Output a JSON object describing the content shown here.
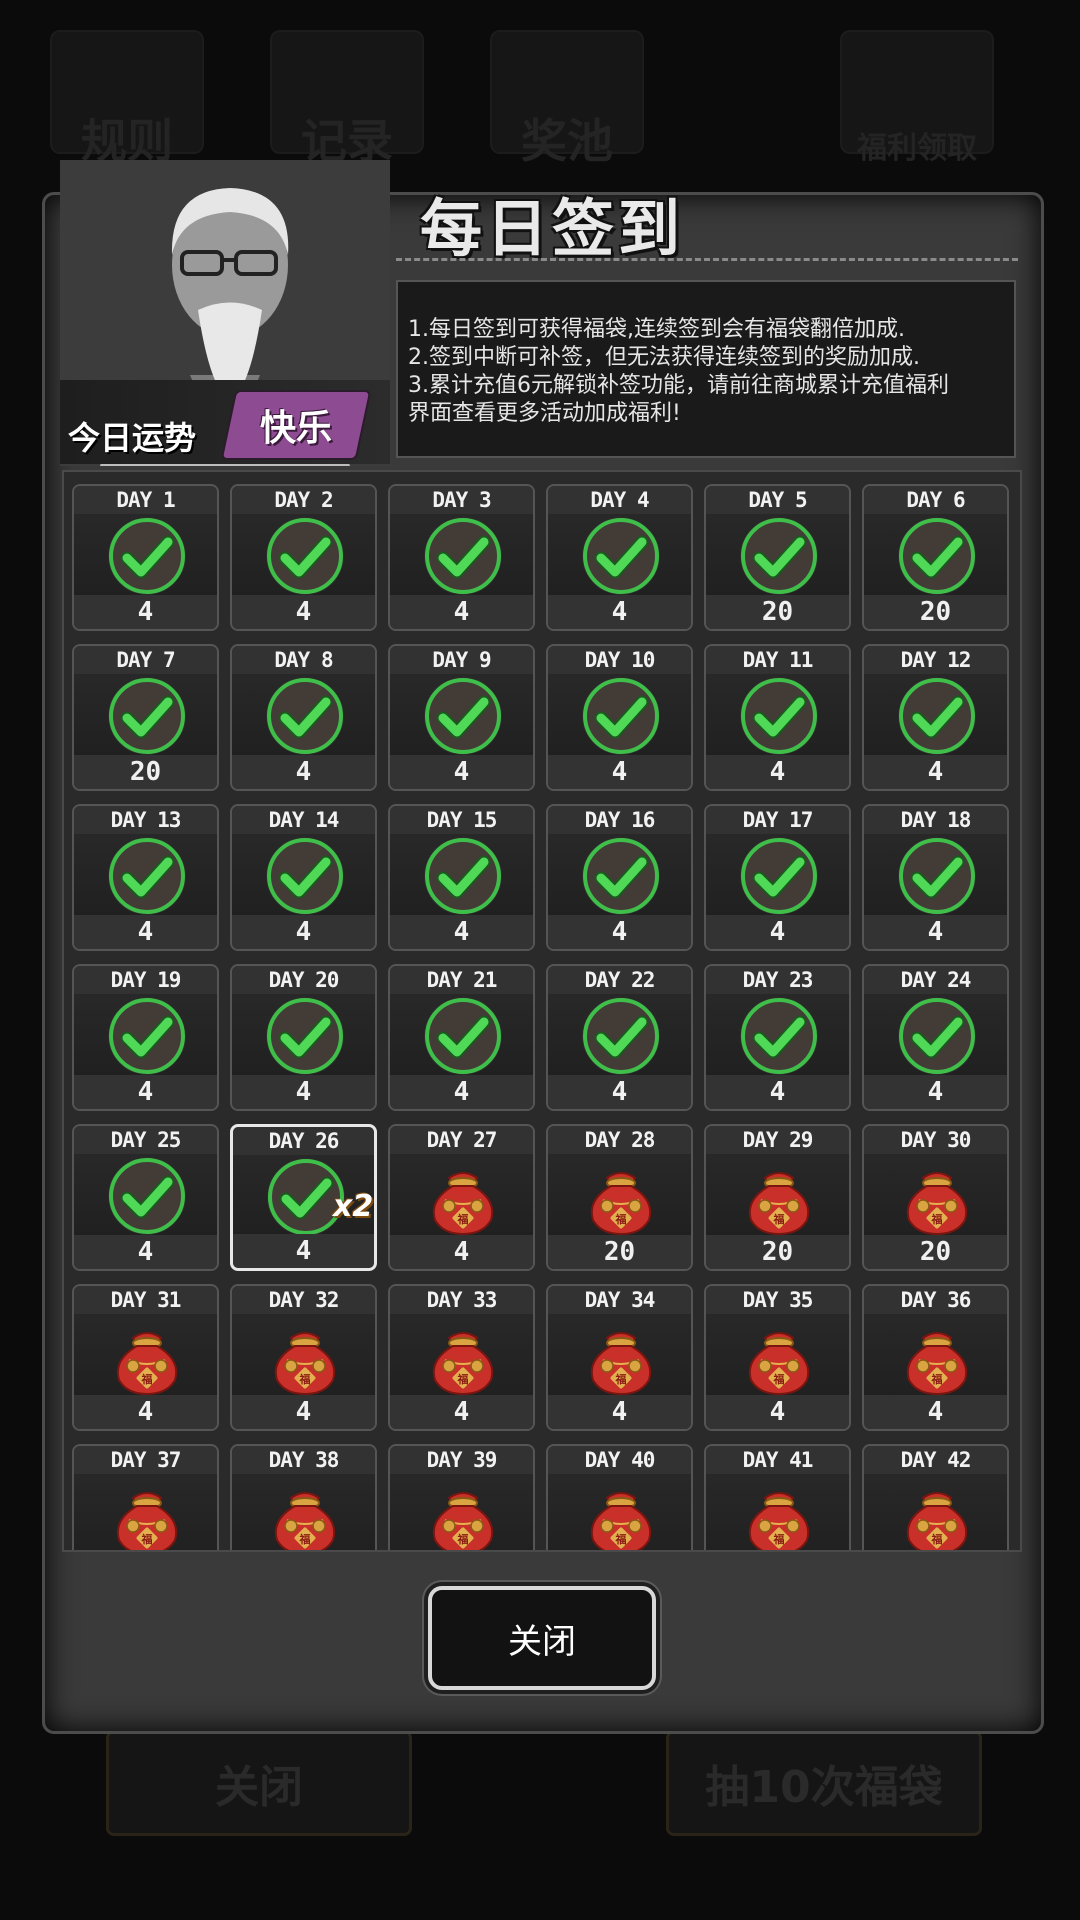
{
  "background": {
    "tabs": [
      {
        "label": "规则"
      },
      {
        "label": "记录"
      },
      {
        "label": "奖池"
      },
      {
        "label": "福利领取"
      }
    ],
    "buttons": [
      {
        "label": "关闭"
      },
      {
        "label": "抽10次福袋"
      }
    ]
  },
  "dialog": {
    "title": "每日签到",
    "fortune_label": "今日运势",
    "fortune_value": "快乐",
    "rules": [
      "1.每日签到可获得福袋,连续签到会有福袋翻倍加成.",
      "2.签到中断可补签，但无法获得连续签到的奖励加成.",
      "3.累计充值6元解锁补签功能，请前往商城累计充值福利",
      "界面查看更多活动加成福利!"
    ],
    "close_label": "关闭",
    "days": [
      {
        "day": "DAY 1",
        "reward": "4",
        "status": "checked"
      },
      {
        "day": "DAY 2",
        "reward": "4",
        "status": "checked"
      },
      {
        "day": "DAY 3",
        "reward": "4",
        "status": "checked"
      },
      {
        "day": "DAY 4",
        "reward": "4",
        "status": "checked"
      },
      {
        "day": "DAY 5",
        "reward": "20",
        "status": "checked"
      },
      {
        "day": "DAY 6",
        "reward": "20",
        "status": "checked"
      },
      {
        "day": "DAY 7",
        "reward": "20",
        "status": "checked"
      },
      {
        "day": "DAY 8",
        "reward": "4",
        "status": "checked"
      },
      {
        "day": "DAY 9",
        "reward": "4",
        "status": "checked"
      },
      {
        "day": "DAY 10",
        "reward": "4",
        "status": "checked"
      },
      {
        "day": "DAY 11",
        "reward": "4",
        "status": "checked"
      },
      {
        "day": "DAY 12",
        "reward": "4",
        "status": "checked"
      },
      {
        "day": "DAY 13",
        "reward": "4",
        "status": "checked"
      },
      {
        "day": "DAY 14",
        "reward": "4",
        "status": "checked"
      },
      {
        "day": "DAY 15",
        "reward": "4",
        "status": "checked"
      },
      {
        "day": "DAY 16",
        "reward": "4",
        "status": "checked"
      },
      {
        "day": "DAY 17",
        "reward": "4",
        "status": "checked"
      },
      {
        "day": "DAY 18",
        "reward": "4",
        "status": "checked"
      },
      {
        "day": "DAY 19",
        "reward": "4",
        "status": "checked"
      },
      {
        "day": "DAY 20",
        "reward": "4",
        "status": "checked"
      },
      {
        "day": "DAY 21",
        "reward": "4",
        "status": "checked"
      },
      {
        "day": "DAY 22",
        "reward": "4",
        "status": "checked"
      },
      {
        "day": "DAY 23",
        "reward": "4",
        "status": "checked"
      },
      {
        "day": "DAY 24",
        "reward": "4",
        "status": "checked"
      },
      {
        "day": "DAY 25",
        "reward": "4",
        "status": "checked"
      },
      {
        "day": "DAY 26",
        "reward": "4",
        "status": "checked",
        "current": true,
        "multiplier": "x2"
      },
      {
        "day": "DAY 27",
        "reward": "4",
        "status": "locked"
      },
      {
        "day": "DAY 28",
        "reward": "20",
        "status": "locked"
      },
      {
        "day": "DAY 29",
        "reward": "20",
        "status": "locked"
      },
      {
        "day": "DAY 30",
        "reward": "20",
        "status": "locked"
      },
      {
        "day": "DAY 31",
        "reward": "4",
        "status": "locked"
      },
      {
        "day": "DAY 32",
        "reward": "4",
        "status": "locked"
      },
      {
        "day": "DAY 33",
        "reward": "4",
        "status": "locked"
      },
      {
        "day": "DAY 34",
        "reward": "4",
        "status": "locked"
      },
      {
        "day": "DAY 35",
        "reward": "4",
        "status": "locked"
      },
      {
        "day": "DAY 36",
        "reward": "4",
        "status": "locked"
      },
      {
        "day": "DAY 37",
        "status": "locked"
      },
      {
        "day": "DAY 38",
        "status": "locked"
      },
      {
        "day": "DAY 39",
        "status": "locked"
      },
      {
        "day": "DAY 40",
        "status": "locked"
      },
      {
        "day": "DAY 41",
        "status": "locked"
      },
      {
        "day": "DAY 42",
        "status": "locked"
      }
    ]
  },
  "icons": {
    "checked": "check-circle-icon",
    "locked": "lucky-bag-icon"
  },
  "colors": {
    "check_green": "#3fbf4a",
    "bag_red": "#c9302a",
    "bag_gold": "#d9a441"
  }
}
